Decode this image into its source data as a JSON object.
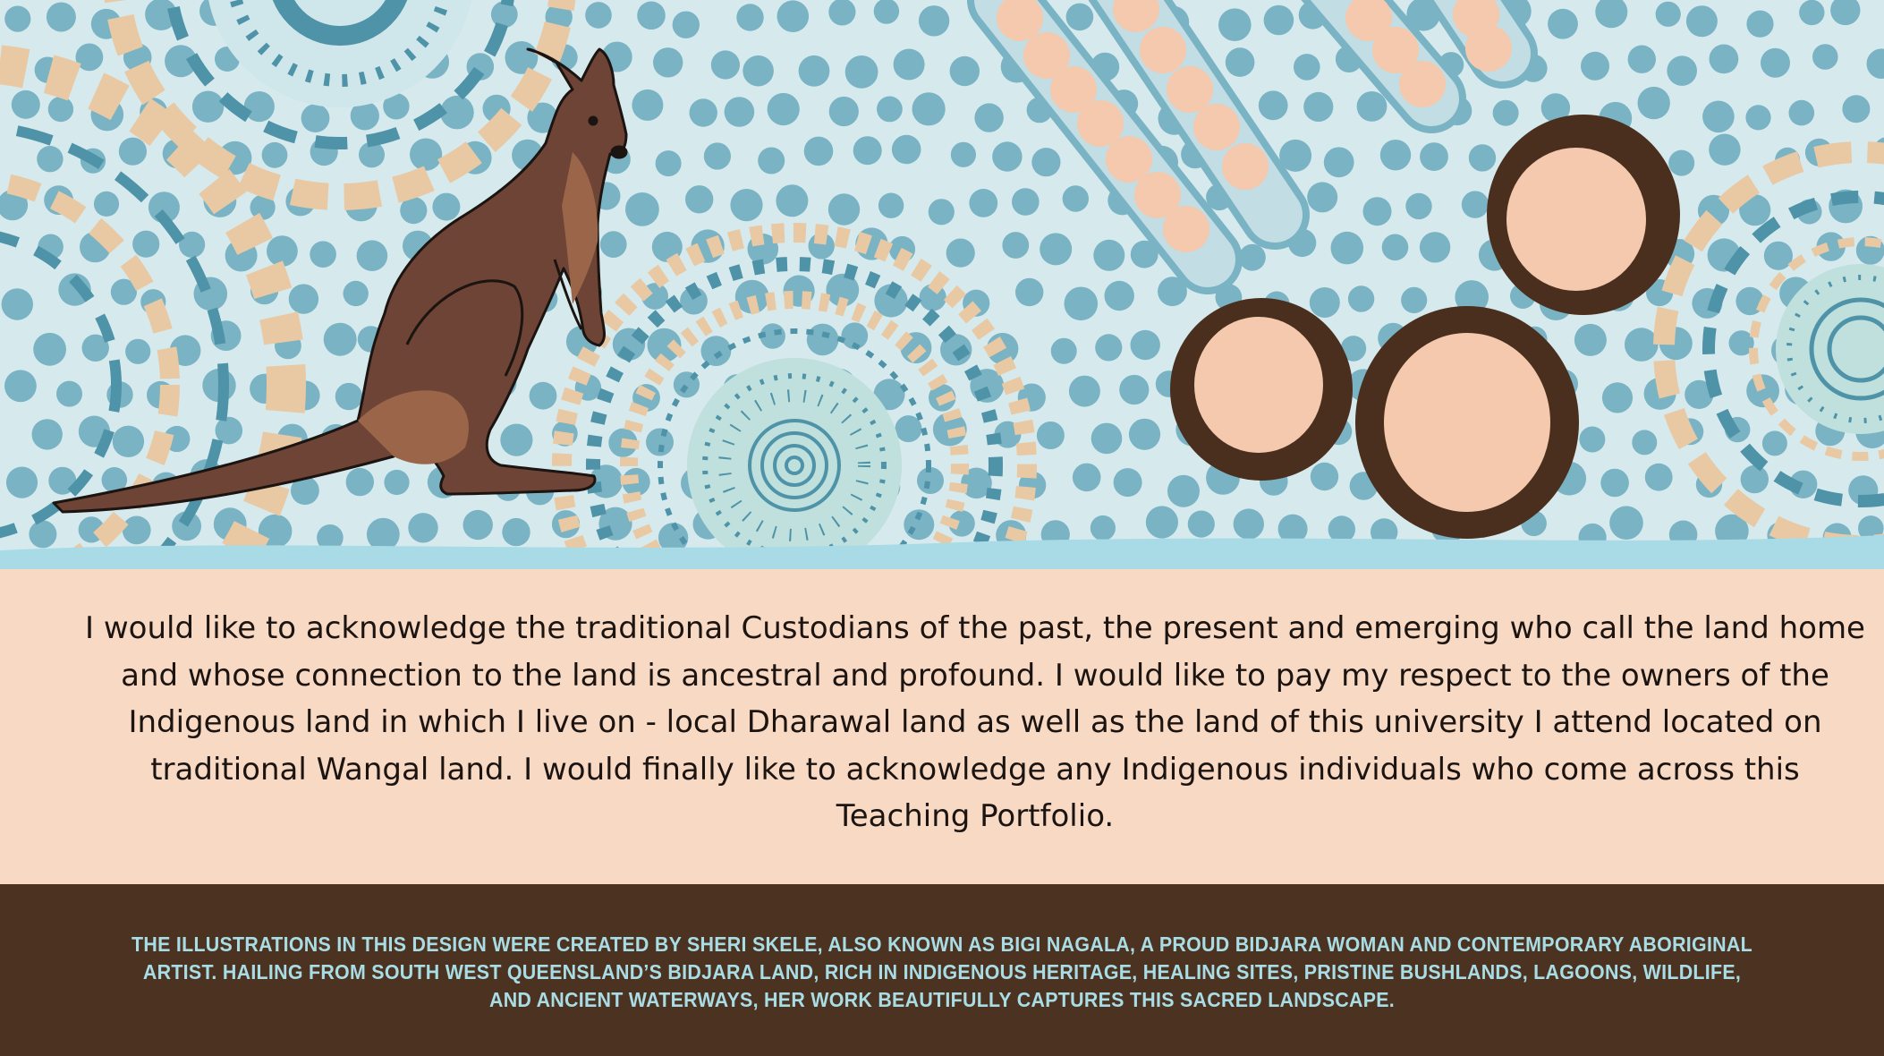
{
  "acknowledgement": {
    "text": "I would like to acknowledge the traditional Custodians of the past, the present and emerging who call the land home and whose connection to the land is ancestral and profound. I would like to pay my respect to the owners of the Indigenous land in which I live on - local Dharawal land as well as the land of this university I attend located on traditional Wangal land. I would finally like to acknowledge any Indigenous individuals who come across this Teaching Portfolio."
  },
  "credit": {
    "text": "The illustrations in this design were created by Sheri Skele, also known as Bigi Nagala, a proud Bidjara woman and contemporary Aboriginal artist. Hailing from South West Queensland’s Bidjara land, rich in Indigenous heritage, healing sites, pristine bushlands, lagoons, wildlife, and ancient waterways, her work beautifully captures this sacred landscape."
  },
  "colors": {
    "sky": "#cfe6ea",
    "dot_blue": "#79b3c4",
    "dash_blue": "#4f93a8",
    "sand": "#e8c9a4",
    "peach": "#f4c9ad",
    "brown_dark": "#4c3221",
    "kangaroo": "#6d4436",
    "kangaroo_light": "#9a6548",
    "water": "#a8dbe6",
    "page": "#f8d9c4"
  },
  "illustrations": [
    "kangaroo",
    "waterhole-circles",
    "dot-patterns",
    "concentric-motifs"
  ]
}
